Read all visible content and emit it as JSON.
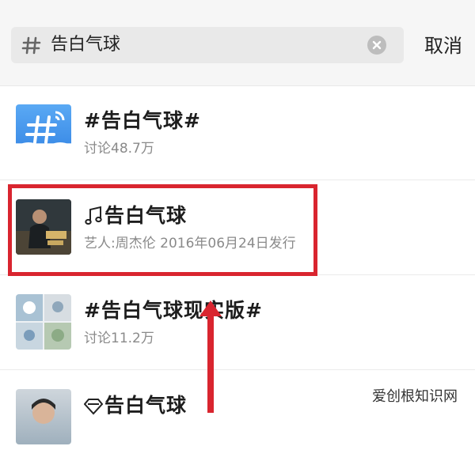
{
  "search": {
    "query": "告白气球",
    "cancel_label": "取消"
  },
  "results": [
    {
      "type": "topic",
      "title": "#告白气球#",
      "subtitle": "讨论48.7万",
      "thumbnail_icon": "topic-hash-cloud-icon"
    },
    {
      "type": "music",
      "title": "告白气球",
      "subtitle": "艺人:周杰伦   2016年06月24日发行",
      "thumbnail_icon": "album-cover",
      "title_icon": "music-note-icon"
    },
    {
      "type": "topic",
      "title": "#告白气球现实版#",
      "subtitle": "讨论11.2万",
      "thumbnail_icon": "photo-collage"
    },
    {
      "type": "other",
      "title": "告白气球",
      "subtitle": "",
      "thumbnail_icon": "person-photo",
      "title_icon": "diamond-icon"
    }
  ],
  "annotation": {
    "highlight_color": "#d9252f",
    "highlighted_result_index": 1
  },
  "watermark": {
    "text": "爱创根知识网"
  }
}
